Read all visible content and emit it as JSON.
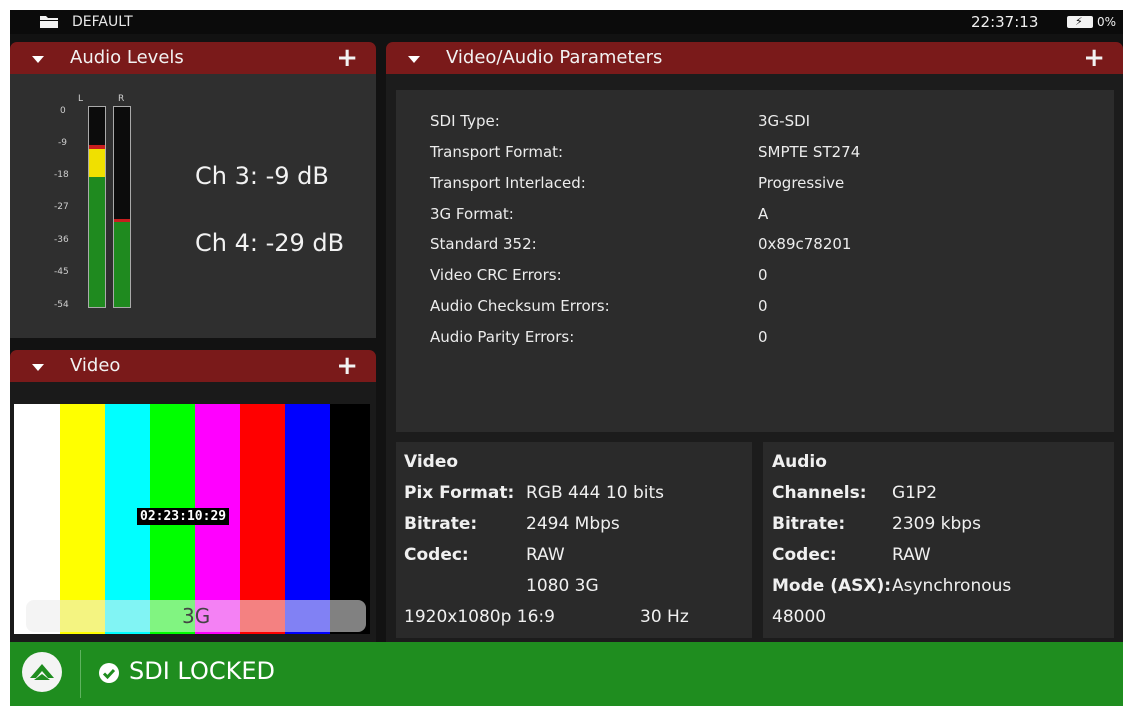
{
  "topbar": {
    "profile": "DEFAULT",
    "clock": "22:37:13",
    "battery_pct": "0%"
  },
  "audio_panel": {
    "title": "Audio Levels",
    "meter_labels": [
      "L",
      "R"
    ],
    "scale": [
      "0",
      "-9",
      "-18",
      "-27",
      "-36",
      "-45",
      "-54"
    ],
    "ch3": "Ch 3: -9 dB",
    "ch4": "Ch 4: -29 dB",
    "levels_db": {
      "ch3": -9,
      "ch4": -29
    }
  },
  "video_panel": {
    "title": "Video",
    "timecode": "02:23:10:29",
    "format_badge": "3G"
  },
  "params_panel": {
    "title": "Video/Audio Parameters",
    "rows": [
      {
        "label": "SDI Type:",
        "value": "3G-SDI"
      },
      {
        "label": "Transport Format:",
        "value": "SMPTE ST274"
      },
      {
        "label": "Transport Interlaced:",
        "value": "Progressive"
      },
      {
        "label": "3G Format:",
        "value": "A"
      },
      {
        "label": "Standard 352:",
        "value": "0x89c78201"
      },
      {
        "label": "Video CRC Errors:",
        "value": "0"
      },
      {
        "label": "Audio Checksum Errors:",
        "value": "0"
      },
      {
        "label": "Audio Parity Errors:",
        "value": "0"
      }
    ]
  },
  "video_info": {
    "heading": "Video",
    "pix_format_label": "Pix Format:",
    "pix_format": "RGB 444 10 bits",
    "bitrate_label": "Bitrate:",
    "bitrate": "2494 Mbps",
    "codec_label": "Codec:",
    "codec": "RAW",
    "standard": "1080 3G",
    "resolution": "1920x1080p 16:9",
    "rate": "30 Hz"
  },
  "audio_info": {
    "heading": "Audio",
    "channels_label": "Channels:",
    "channels": "G1P2",
    "bitrate_label": "Bitrate:",
    "bitrate": "2309 kbps",
    "codec_label": "Codec:",
    "codec": "RAW",
    "mode_label": "Mode (ASX):",
    "mode": "Asynchronous",
    "sample_rate": "48000"
  },
  "status": {
    "text": "SDI LOCKED",
    "color": "#1f8d1f"
  }
}
